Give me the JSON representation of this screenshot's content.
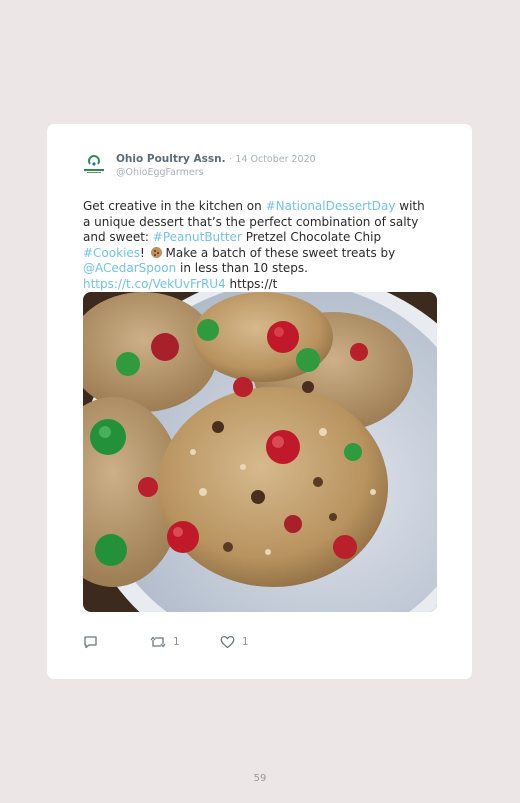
{
  "tweet": {
    "author_name": "Ohio Poultry Assn.",
    "separator": "·",
    "date": "14 October 2020",
    "handle": "@OhioEggFarmers",
    "text": {
      "t1": "Get creative in the kitchen on ",
      "tag1": "#NationalDessertDay",
      "t2": " with a unique dessert that’s the perfect combination of salty and sweet: ",
      "tag2": "#PeanutButter",
      "t3": " Pretzel Chocolate Chip ",
      "tag3": "#Cookies",
      "t4": "! ",
      "t5": " Make a batch of these sweet treats by ",
      "mention": "@ACedarSpoon",
      "t6": " in less than 10 steps. ",
      "link": "https://t.co/VekUvFrRU4",
      "t7": " https://t"
    },
    "emoji": "cookie-emoji",
    "image": "photo of M&M oatmeal cookies on a plate",
    "actions": {
      "reply_count": "",
      "retweet_count": "1",
      "like_count": "1"
    }
  },
  "page_number": "59",
  "colors": {
    "page_background": "#ece7e6",
    "card": "#ffffff",
    "link": "#72c3e8",
    "name": "#5b6b78",
    "muted": "#a9b2ba"
  }
}
